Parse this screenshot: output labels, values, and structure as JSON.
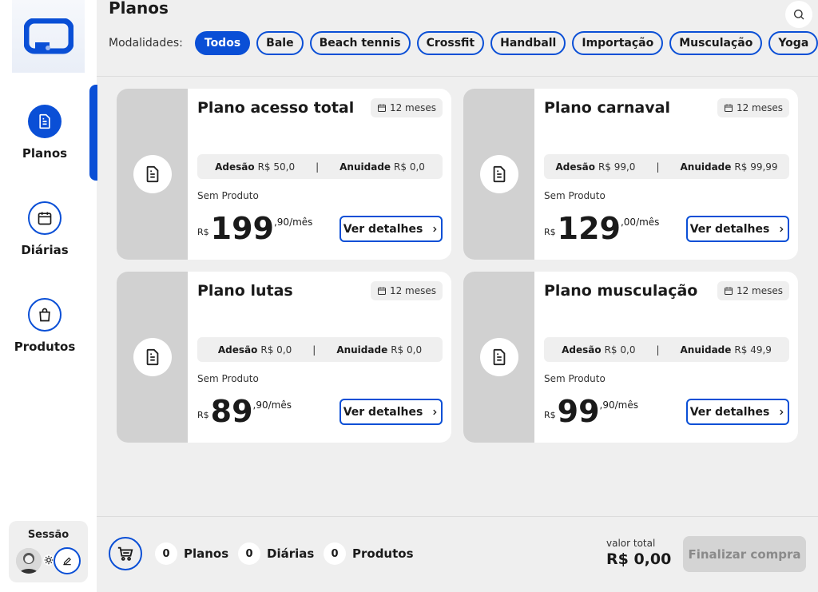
{
  "sidebar": {
    "items": [
      {
        "label": "Planos",
        "icon": "document-icon"
      },
      {
        "label": "Diárias",
        "icon": "calendar-icon"
      },
      {
        "label": "Produtos",
        "icon": "shopping-bag-icon"
      }
    ],
    "session_label": "Sessão"
  },
  "header": {
    "title": "Planos",
    "filter_label": "Modalidades:",
    "chips": [
      "Todos",
      "Bale",
      "Beach tennis",
      "Crossfit",
      "Handball",
      "Importação",
      "Musculação",
      "Yoga"
    ],
    "active_chip": "Todos"
  },
  "plans": [
    {
      "name": "Plano acesso total",
      "duration": "12 meses",
      "adesao_label": "Adesão",
      "adesao": "R$ 50,0",
      "anuidade_label": "Anuidade",
      "anuidade": "R$ 0,0",
      "product": "Sem Produto",
      "currency": "R$",
      "price_int": "199",
      "price_dec": ",90/mês",
      "button": "Ver detalhes"
    },
    {
      "name": "Plano carnaval",
      "duration": "12 meses",
      "adesao_label": "Adesão",
      "adesao": "R$ 99,0",
      "anuidade_label": "Anuidade",
      "anuidade": "R$ 99,99",
      "product": "Sem Produto",
      "currency": "R$",
      "price_int": "129",
      "price_dec": ",00/mês",
      "button": "Ver detalhes"
    },
    {
      "name": "Plano lutas",
      "duration": "12 meses",
      "adesao_label": "Adesão",
      "adesao": "R$ 0,0",
      "anuidade_label": "Anuidade",
      "anuidade": "R$ 0,0",
      "product": "Sem Produto",
      "currency": "R$",
      "price_int": "89",
      "price_dec": ",90/mês",
      "button": "Ver detalhes"
    },
    {
      "name": "Plano musculação",
      "duration": "12 meses",
      "adesao_label": "Adesão",
      "adesao": "R$ 0,0",
      "anuidade_label": "Anuidade",
      "anuidade": "R$ 49,9",
      "product": "Sem Produto",
      "currency": "R$",
      "price_int": "99",
      "price_dec": ",90/mês",
      "button": "Ver detalhes"
    }
  ],
  "footer": {
    "planos_count": "0",
    "planos_label": "Planos",
    "diarias_count": "0",
    "diarias_label": "Diárias",
    "produtos_count": "0",
    "produtos_label": "Produtos",
    "total_label": "valor total",
    "total_value": "R$ 0,00",
    "checkout_label": "Finalizar compra"
  },
  "colors": {
    "accent": "#0a4fd6",
    "background": "#efefef",
    "card_side": "#d1d1d1",
    "disabled": "#d4d4d4"
  }
}
